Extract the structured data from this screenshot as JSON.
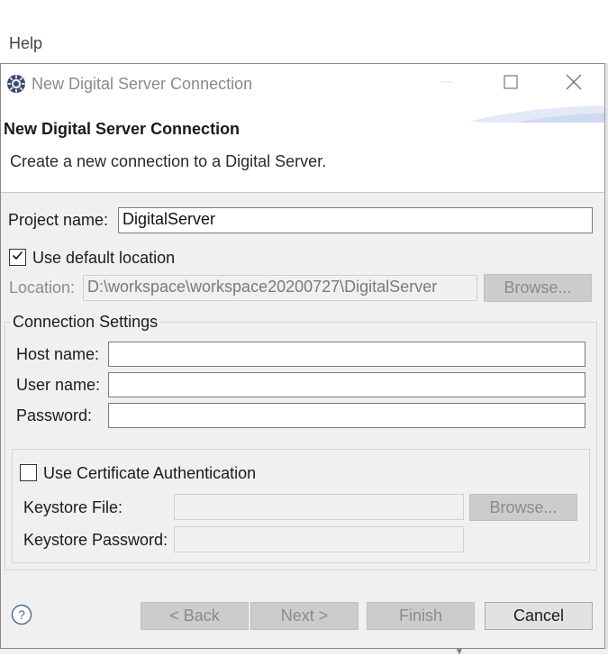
{
  "background": {
    "menu_help": "Help"
  },
  "window": {
    "title": "New Digital Server Connection",
    "app_icon": "eclipse-gear-icon",
    "controls": [
      "minimize-icon",
      "maximize-icon",
      "close-icon"
    ]
  },
  "banner": {
    "title": "New Digital Server Connection",
    "description": "Create a new connection to a Digital Server."
  },
  "form": {
    "project_name_label": "Project name:",
    "project_name_value": "DigitalServer",
    "use_default_location_label": "Use default location",
    "use_default_location_checked": true,
    "location_label": "Location:",
    "location_value": "D:\\workspace\\workspace20200727\\DigitalServer",
    "browse_label": "Browse..."
  },
  "connection_settings": {
    "legend": "Connection Settings",
    "host_label": "Host name:",
    "host_value": "",
    "user_label": "User name:",
    "user_value": "",
    "password_label": "Password:",
    "password_value": ""
  },
  "certificate": {
    "use_cert_label": "Use Certificate Authentication",
    "use_cert_checked": false,
    "keystore_file_label": "Keystore File:",
    "keystore_file_value": "",
    "browse_label": "Browse...",
    "keystore_password_label": "Keystore Password:",
    "keystore_password_value": ""
  },
  "buttons": {
    "help_icon": "help-icon",
    "back": "< Back",
    "next": "Next >",
    "finish": "Finish",
    "cancel": "Cancel"
  }
}
